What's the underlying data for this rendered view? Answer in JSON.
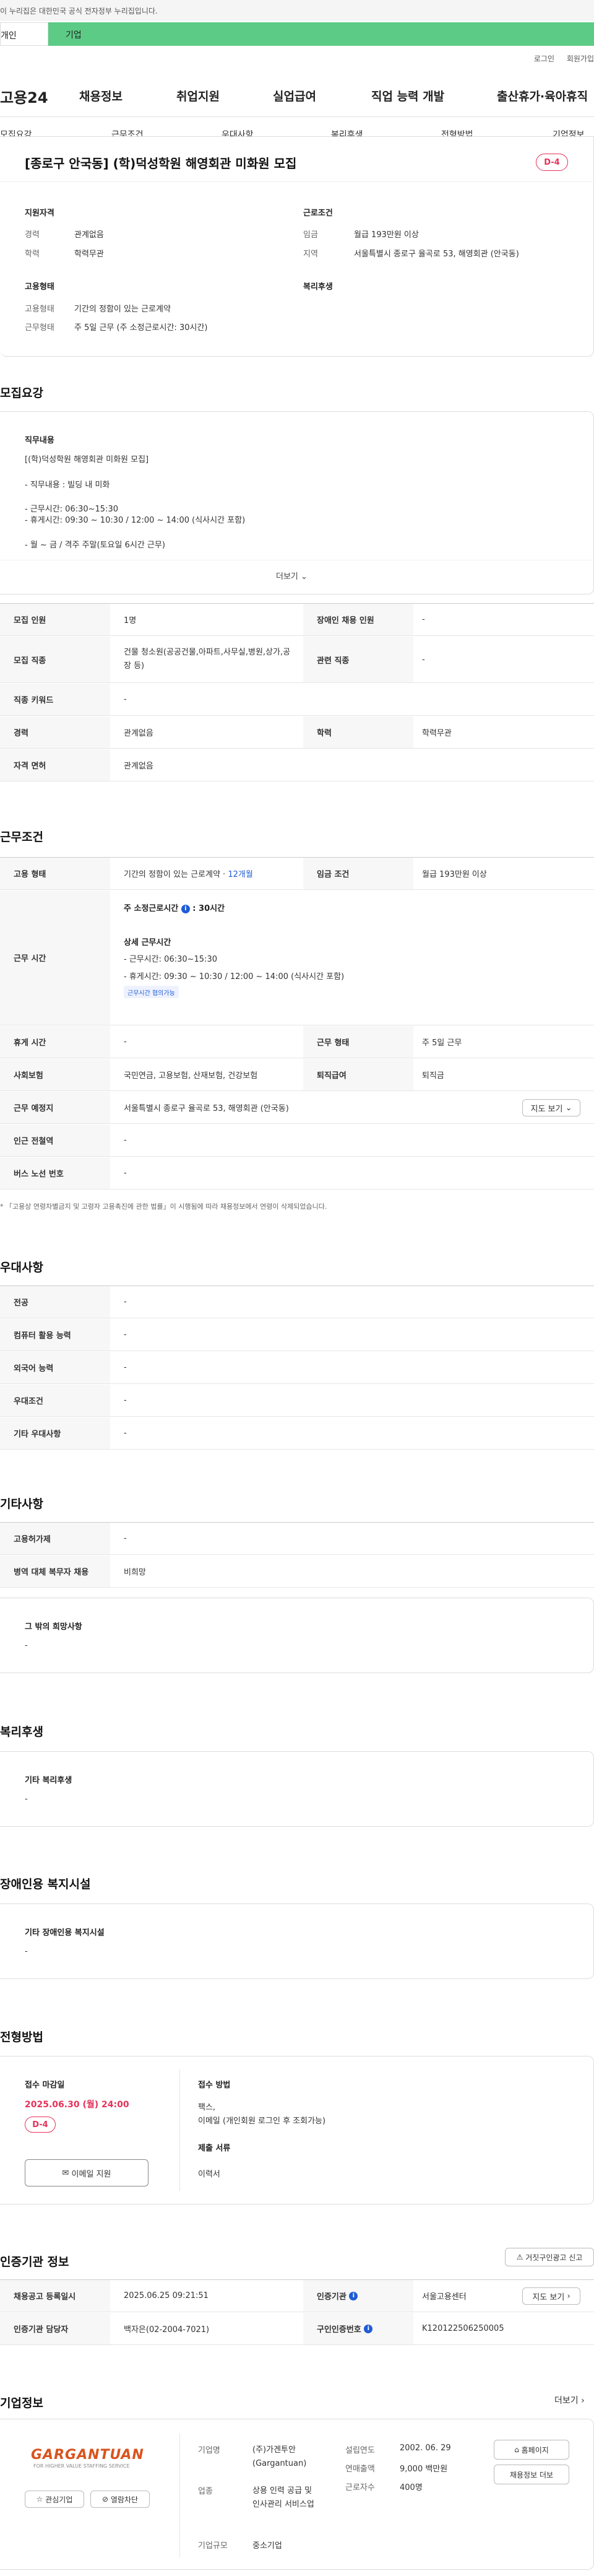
{
  "gov_banner": "이 누리집은 대한민국 공식 전자정부 누리집입니다.",
  "user_tabs": [
    "개인",
    "기업"
  ],
  "top_links": [
    "로그인",
    "회원가입"
  ],
  "logo": "고용24",
  "gnb": [
    "채용정보",
    "취업지원",
    "실업급여",
    "직업 능력 개발",
    "출산휴가·육아휴직"
  ],
  "subnav": [
    "모집요강",
    "근무조건",
    "우대사항",
    "복리후생",
    "전형방법",
    "기업정보"
  ],
  "job": {
    "title": "[종로구 안국동] (학)덕성학원 해영회관 미화원 모집",
    "dday": "D-4",
    "summary": {
      "qual_title": "지원자격",
      "cond_title": "근로조건",
      "emp_title": "고용형태",
      "welfare_title": "복리후생",
      "career_label": "경력",
      "career": "관계없음",
      "edu_label": "학력",
      "edu": "학력무관",
      "wage_label": "임금",
      "wage": "월급 193만원 이상",
      "region_label": "지역",
      "region": "서울특별시 종로구 율곡로 53, 해영회관 (안국동)",
      "emptype_label": "고용형태",
      "emptype": "기간의 정함이 있는 근로계약",
      "worktype_label": "근무형태",
      "worktype": "주 5일 근무 (주 소정근로시간: 30시간)"
    }
  },
  "recruit": {
    "title": "모집요강",
    "duty_title": "직무내용",
    "duty_lines": [
      "[(학)덕성학원 해영회관 미화원 모집]",
      "- 직무내용 : 빌딩 내 미화",
      "- 근무시간: 06:30~15:30",
      "- 휴게시간: 09:30 ~ 10:30 / 12:00 ~ 14:00 (식사시간 포함)",
      "- 월 ~ 금 / 격주 주말(토요일 6시간 근무)"
    ],
    "more": "더보기",
    "rows": {
      "count_label": "모집 인원",
      "count": "1명",
      "disabled_label": "장애인 채용 인원",
      "disabled": "-",
      "job_label": "모집 직종",
      "job": "건물 청소원(공공건물,아파트,사무실,병원,상가,공장 등)",
      "related_label": "관련 직종",
      "related": "-",
      "keyword_label": "직종 키워드",
      "keyword": "-",
      "career_label": "경력",
      "career": "관계없음",
      "edu_label": "학력",
      "edu": "학력무관",
      "license_label": "자격 면허",
      "license": "관계없음"
    }
  },
  "conditions": {
    "title": "근무조건",
    "emptype_label": "고용 형태",
    "emptype": "기간의 정함이 있는 근로계약 ·",
    "emptype_months": "12개월",
    "wage_label": "임금 조건",
    "wage": "월급 193만원 이상",
    "hours_label": "근무 시간",
    "weekly": "주 소정근로시간",
    "weekly_hours": "30시간",
    "detail_title": "상세 근무시간",
    "detail_lines": [
      "- 근무시간: 06:30~15:30",
      "- 휴게시간: 09:30 ~ 10:30 / 12:00 ~ 14:00 (식사시간 포함)"
    ],
    "flex_tag": "근무시간 협의가능",
    "rest_label": "휴게 시간",
    "rest": "-",
    "worktype_label": "근무 형태",
    "worktype": "주 5일 근무",
    "insurance_label": "사회보험",
    "insurance": "국민연금, 고용보험, 산재보험, 건강보험",
    "severance_label": "퇴직급여",
    "severance": "퇴직금",
    "place_label": "근무 예정지",
    "place": "서울특별시 종로구 율곡로 53, 해영회관 (안국동)",
    "map_btn": "지도 보기",
    "subway_label": "인근 전철역",
    "subway": "-",
    "bus_label": "버스 노선 번호",
    "bus": "-",
    "note": "* 「고용상 연령차별금지 및 고령자 고용촉진에 관한 법률」이 시행됨에 따라 채용정보에서 연령이 삭제되었습니다."
  },
  "preference": {
    "title": "우대사항",
    "rows": [
      {
        "label": "전공",
        "value": "-"
      },
      {
        "label": "컴퓨터 활용 능력",
        "value": "-"
      },
      {
        "label": "외국어 능력",
        "value": "-"
      },
      {
        "label": "우대조건",
        "value": "-"
      },
      {
        "label": "기타 우대사항",
        "value": "-"
      }
    ]
  },
  "etc": {
    "title": "기타사항",
    "rows": [
      {
        "label": "고용허가제",
        "value": "-"
      },
      {
        "label": "병역 대체 복무자 채용",
        "value": "비희망"
      }
    ],
    "other_title": "그 밖의 희망사항",
    "other": "-"
  },
  "welfare": {
    "title": "복리후생",
    "box_title": "기타 복리후생",
    "box_value": "-"
  },
  "disabled_facility": {
    "title": "장애인용 복지시설",
    "box_title": "기타 장애인용 복지시설",
    "box_value": "-"
  },
  "process": {
    "title": "전형방법",
    "deadline_label": "접수 마감일",
    "deadline": "2025.06.30 (월) 24:00",
    "dday": "D-4",
    "apply_btn": "이메일 지원",
    "method_label": "접수 방법",
    "method_lines": [
      "팩스,",
      "이메일 (개인회원 로그인 후 조회가능)"
    ],
    "docs_label": "제출 서류",
    "docs": "이력서"
  },
  "cert": {
    "title": "인증기관 정보",
    "report_btn": "거짓구인광고 신고",
    "reg_label": "채용공고 등록일시",
    "reg": "2025.06.25 09:21:51",
    "org_label": "인증기관",
    "org": "서울고용센터",
    "map_btn": "지도 보기",
    "mgr_label": "인증기관 담당자",
    "mgr": "백자은(02-2004-7021)",
    "no_label": "구인인증번호",
    "no": "K120122506250005"
  },
  "company": {
    "title": "기업정보",
    "more": "더보기",
    "logo": "GARGANTUAN",
    "logo_sub": "FOR HIGHER VALUE STAFFING SERVICE",
    "fav_btn": "관심기업",
    "block_btn": "열람차단",
    "name_label": "기업명",
    "name": "(주)가겐투안(Gargantuan)",
    "industry_label": "업종",
    "industry": "상용 인력 공급 및 인사관리 서비스업",
    "size_label": "기업규모",
    "size": "중소기업",
    "founded_label": "설립연도",
    "founded": "2002. 06. 29",
    "sales_label": "연매출액",
    "sales": "9,000 백만원",
    "staff_label": "근로자수",
    "staff": "400명",
    "home_btn": "홈페이지",
    "jobs_btn": "채용정보 더보"
  }
}
